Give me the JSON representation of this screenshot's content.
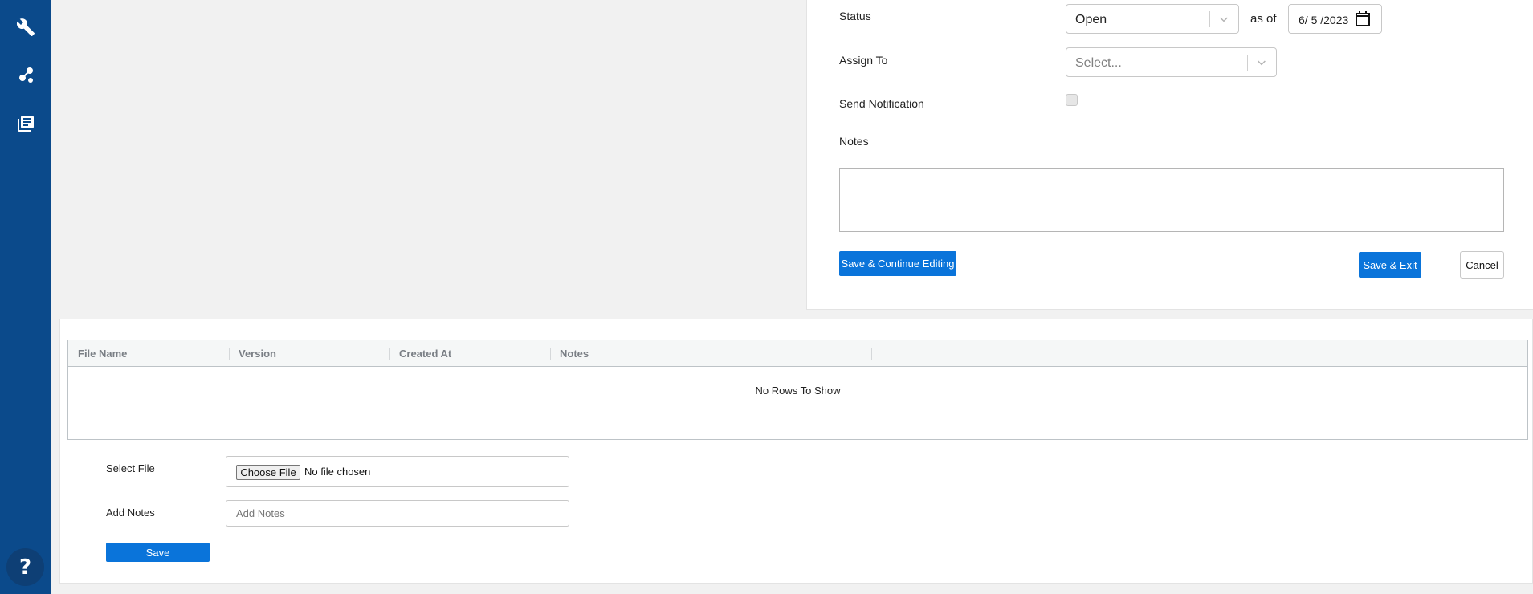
{
  "colors": {
    "sidebar": "#0b4a8b",
    "primary_button": "#0a74da",
    "page_background": "#f1f1f1"
  },
  "sidebar": {
    "items": [
      {
        "icon": "wrench-icon"
      },
      {
        "icon": "nodes-icon"
      },
      {
        "icon": "documents-icon"
      }
    ],
    "help_label": "?"
  },
  "form": {
    "status_label": "Status",
    "status_value": "Open",
    "as_of_label": "as of",
    "date_value": "6/ 5 /2023",
    "assign_label": "Assign To",
    "assign_placeholder": "Select...",
    "notification_label": "Send Notification",
    "notification_checked": false,
    "notes_label": "Notes",
    "notes_value": "",
    "save_continue_label": "Save & Continue Editing",
    "save_exit_label": "Save & Exit",
    "cancel_label": "Cancel"
  },
  "files": {
    "columns": [
      "File Name",
      "Version",
      "Created At",
      "Notes",
      ""
    ],
    "rows": [],
    "empty_text": "No Rows To Show",
    "select_file_label": "Select File",
    "choose_file_label": "Choose File",
    "file_status": "No file chosen",
    "add_notes_label": "Add Notes",
    "add_notes_placeholder": "Add Notes",
    "save_label": "Save"
  }
}
